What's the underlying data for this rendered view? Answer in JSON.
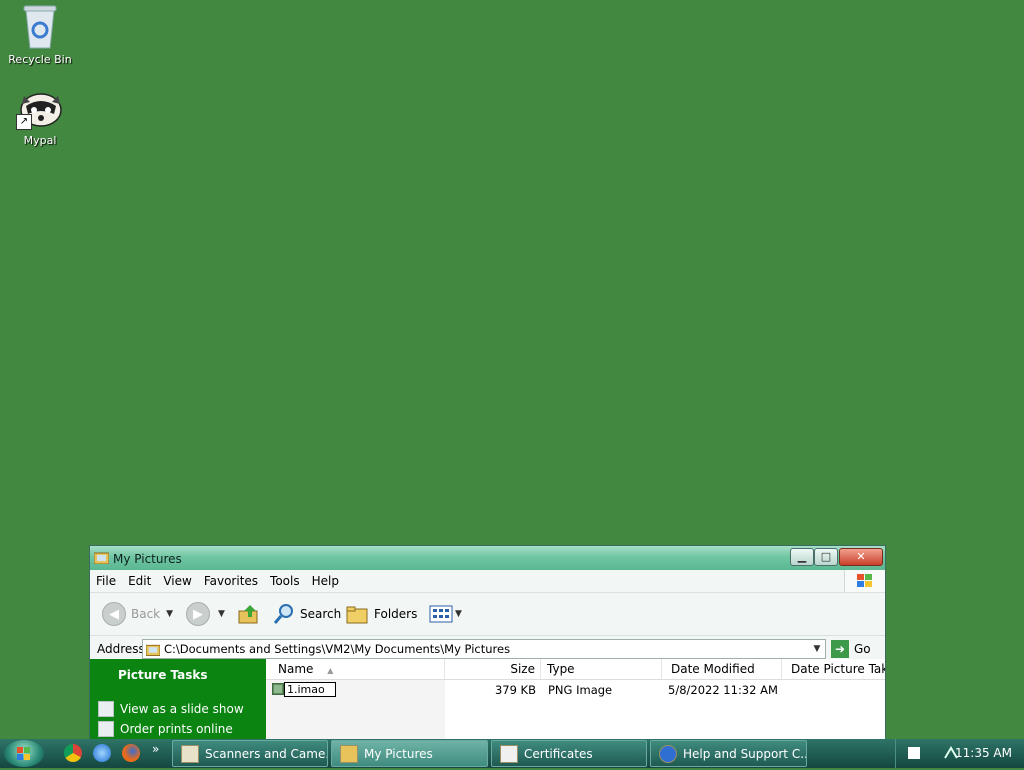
{
  "desktop": {
    "icons": [
      {
        "label": "Recycle Bin",
        "icon": "recycle-bin-icon"
      },
      {
        "label": "Mypal",
        "icon": "raccoon-icon"
      }
    ]
  },
  "window": {
    "title": "My Pictures",
    "menu": [
      "File",
      "Edit",
      "View",
      "Favorites",
      "Tools",
      "Help"
    ],
    "toolbar": {
      "back_label": "Back",
      "search_label": "Search",
      "folders_label": "Folders"
    },
    "address": {
      "label": "Address",
      "value": "C:\\Documents and Settings\\VM2\\My Documents\\My Pictures",
      "go_label": "Go"
    },
    "tasks": {
      "header": "Picture Tasks",
      "items": [
        "View as a slide show",
        "Order prints online"
      ]
    },
    "columns": [
      "Name",
      "Size",
      "Type",
      "Date Modified",
      "Date Picture Taken"
    ],
    "files": [
      {
        "name": "1.imao",
        "size": "379 KB",
        "type": "PNG Image",
        "date_modified": "5/8/2022 11:32 AM",
        "date_taken": ""
      }
    ]
  },
  "taskbar": {
    "buttons": [
      {
        "label": "Scanners and Came...",
        "active": false
      },
      {
        "label": "My Pictures",
        "active": true
      },
      {
        "label": "Certificates",
        "active": false
      },
      {
        "label": "Help and Support C...",
        "active": false
      }
    ],
    "quicklaunch": [
      "chrome-icon",
      "internet-explorer-icon",
      "firefox-icon"
    ],
    "overflow": "»",
    "clock": "11:35 AM"
  }
}
